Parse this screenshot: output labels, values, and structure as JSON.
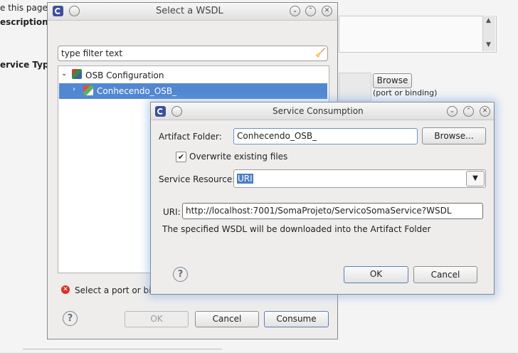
{
  "background": {
    "text_a": "e this page",
    "text_b": "escription",
    "text_c": "ervice Type",
    "browse_label": "Browse",
    "port_hint": "(port or binding)"
  },
  "wsdl_dialog": {
    "title": "Select a WSDL",
    "filter_placeholder": "type filter text",
    "tree": [
      {
        "label": "OSB Configuration",
        "expanded": true,
        "icon": "osb-config-icon"
      },
      {
        "label": "Conhecendo_OSB_",
        "expanded": false,
        "selected": true,
        "icon": "project-icon"
      }
    ],
    "error_text": "Select a port or binding",
    "ok_label": "OK",
    "cancel_label": "Cancel",
    "consume_label": "Consume"
  },
  "service_dialog": {
    "title": "Service Consumption",
    "artifact_folder_label": "Artifact Folder:",
    "artifact_folder_value": "Conhecendo_OSB_",
    "browse_label": "Browse...",
    "overwrite_label": "Overwrite existing files",
    "overwrite_checked": true,
    "service_resource_label": "Service Resource:",
    "service_resource_value": "URI",
    "uri_label": "URI:",
    "uri_value": "http://localhost:7001/SomaProjeto/ServicoSomaService?WSDL",
    "info_text": "The specified WSDL will be downloaded into the Artifact Folder",
    "ok_label": "OK",
    "cancel_label": "Cancel"
  },
  "colors": {
    "selection": "#5287d2",
    "accent_border": "#6a94c8",
    "error": "#d9302a"
  }
}
